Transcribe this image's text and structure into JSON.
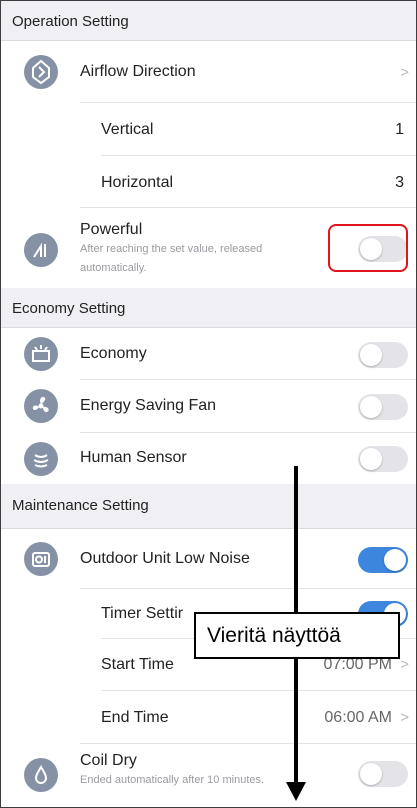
{
  "sections": {
    "operation": "Operation Setting",
    "economy": "Economy Setting",
    "maintenance": "Maintenance Setting"
  },
  "airflow": {
    "label": "Airflow Direction",
    "chevron": ">",
    "icon": "airflow-direction-icon"
  },
  "vertical": {
    "label": "Vertical",
    "value": "1"
  },
  "horizontal": {
    "label": "Horizontal",
    "value": "3"
  },
  "powerful": {
    "label": "Powerful",
    "sub_line1": "After reaching the set value, released",
    "sub_line2": "automatically.",
    "on": false,
    "icon": "powerful-icon"
  },
  "economy": {
    "label": "Economy",
    "on": false,
    "icon": "economy-icon"
  },
  "energy_fan": {
    "label": "Energy Saving Fan",
    "on": false,
    "icon": "fan-icon"
  },
  "human_sensor": {
    "label": "Human Sensor",
    "on": false,
    "icon": "human-sensor-icon"
  },
  "low_noise": {
    "label": "Outdoor Unit Low Noise",
    "on": true,
    "icon": "low-noise-icon"
  },
  "timer": {
    "label": "Timer Settir",
    "on": true
  },
  "start_time": {
    "label": "Start Time",
    "value": "07:00 PM",
    "chevron": ">"
  },
  "end_time": {
    "label": "End Time",
    "value": "06:00 AM",
    "chevron": ">"
  },
  "coil_dry": {
    "label": "Coil Dry",
    "sub": "Ended automatically after 10 minutes.",
    "on": false,
    "icon": "coil-dry-icon"
  },
  "annotation": {
    "callout": "Vieritä näyttöä"
  },
  "colors": {
    "icon_bg": "#8592a6",
    "toggle_on": "#3d86dd",
    "toggle_off": "#e4e4e8",
    "header_bg": "#efeff4",
    "highlight": "#e0141b"
  }
}
